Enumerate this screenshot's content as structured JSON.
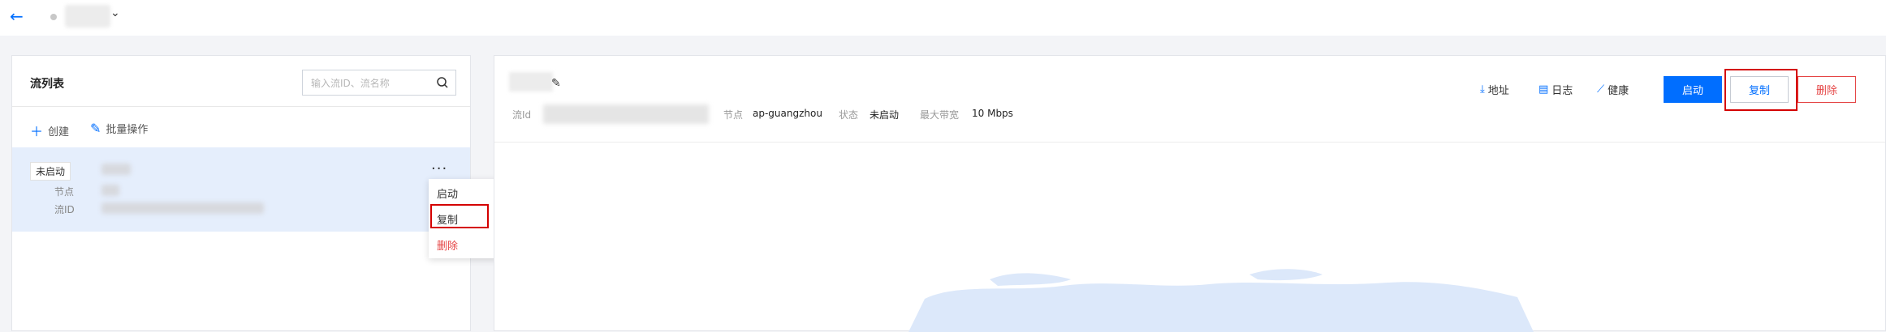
{
  "topbar": {
    "back_icon": "arrow-left-icon",
    "chevron_icon": "chevron-down-icon"
  },
  "left_panel": {
    "title": "流列表",
    "search": {
      "placeholder": "输入流ID、流名称",
      "icon": "search-icon"
    },
    "actions": [
      {
        "label": "创建",
        "icon": "plus-icon"
      },
      {
        "label": "批量操作",
        "icon": "edit-icon"
      }
    ],
    "stream": {
      "status": "未启动",
      "node_label": "节点",
      "id_label": "流ID",
      "more_icon": "more-icon"
    },
    "context_menu": [
      {
        "label": "启动"
      },
      {
        "label": "复制"
      },
      {
        "label": "删除"
      }
    ]
  },
  "detail": {
    "edit_icon": "pencil-icon",
    "meta": {
      "id_label": "流Id",
      "node_label": "节点",
      "node_value": "ap-guangzhou",
      "status_label": "状态",
      "status_value": "未启动",
      "bandwidth_label": "最大带宽",
      "bandwidth_value": "10 Mbps"
    },
    "links": [
      {
        "label": "地址",
        "icon": "download-icon"
      },
      {
        "label": "日志",
        "icon": "document-icon"
      },
      {
        "label": "健康",
        "icon": "chart-icon"
      }
    ],
    "buttons": {
      "start": "启动",
      "copy": "复制",
      "delete": "删除"
    }
  },
  "colors": {
    "primary": "#006eff",
    "danger": "#e54545",
    "highlight": "#d40000",
    "selected_row": "#e5eefc"
  }
}
